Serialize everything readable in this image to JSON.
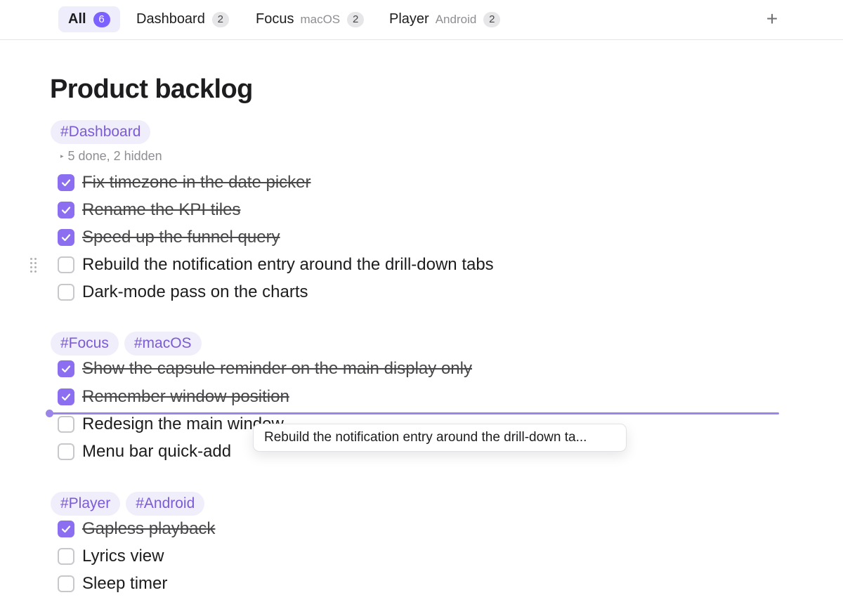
{
  "tabs": [
    {
      "label": "All",
      "sub": "",
      "count": "6"
    },
    {
      "label": "Dashboard",
      "sub": "",
      "count": "2"
    },
    {
      "label": "Focus",
      "sub": "macOS",
      "count": "2"
    },
    {
      "label": "Player",
      "sub": "Android",
      "count": "2"
    }
  ],
  "add_label": "+",
  "page": {
    "title": "Product backlog"
  },
  "groups": [
    {
      "tags": [
        "#Dashboard"
      ],
      "summary": "5 done, 2 hidden",
      "tasks": [
        {
          "label": "Fix timezone in the date picker",
          "done": true
        },
        {
          "label": "Rename the KPI tiles",
          "done": true
        },
        {
          "label": "Speed up the funnel query",
          "done": true
        },
        {
          "label": "Rebuild the notification entry around the drill-down tabs",
          "done": false
        },
        {
          "label": "Dark-mode pass on the charts",
          "done": false
        }
      ]
    },
    {
      "tags": [
        "#Focus",
        "#macOS"
      ],
      "tasks": [
        {
          "label": "Show the capsule reminder on the main display only",
          "done": true
        },
        {
          "label": "Remember window position",
          "done": true
        },
        {
          "label": "Redesign the main window",
          "done": false
        },
        {
          "label": "Menu bar quick-add",
          "done": false
        }
      ]
    },
    {
      "tags": [
        "#Player",
        "#Android"
      ],
      "tasks": [
        {
          "label": "Gapless playback",
          "done": true
        },
        {
          "label": "Lyrics view",
          "done": false
        },
        {
          "label": "Sleep timer",
          "done": false
        }
      ]
    }
  ],
  "drag_ghost": "Rebuild the notification entry around the drill-down ta...",
  "colors": {
    "accent": "#8c6ef0",
    "tag_bg": "#f0eefb",
    "tag_text": "#7b5bd6",
    "drop_line": "#9b85ea"
  }
}
